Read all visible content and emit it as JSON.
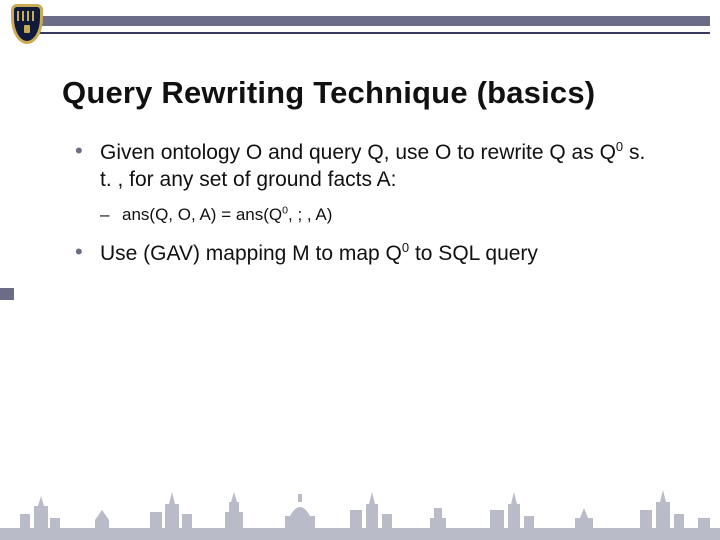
{
  "header": {
    "logo_alt": "University crest"
  },
  "title": "Query Rewriting Technique (basics)",
  "bullets": [
    {
      "type": "level1",
      "text_html": "Given ontology O and query Q, use O to rewrite Q as Q<sup>0</sup> s. t. , for any set of ground facts A:"
    },
    {
      "type": "level2",
      "text_html": "ans(Q, O, A)  =  ans(Q<sup>0</sup>, ; , A)"
    },
    {
      "type": "level1",
      "text_html": "Use (GAV) mapping M to map Q<sup>0</sup> to SQL query"
    }
  ],
  "colors": {
    "accent": "#6b6d86",
    "rule": "#373a5a",
    "crest_fill": "#101a3a",
    "crest_trim": "#c9aa55",
    "skyline": "#b9bbc8"
  }
}
